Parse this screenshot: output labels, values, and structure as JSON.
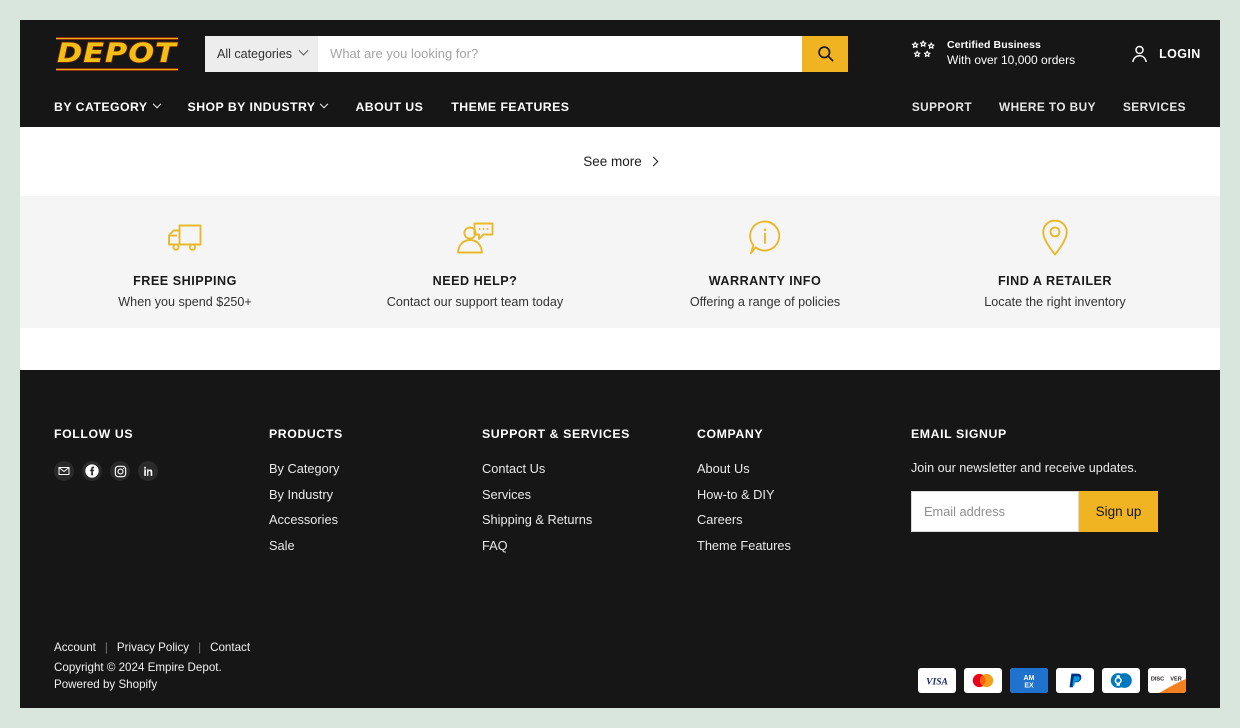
{
  "brand": {
    "logo_text": "DEPOT",
    "accent_color": "#f0b321",
    "logo_yellow": "#f2c014",
    "logo_outline": "#7d2710",
    "header_bg": "#161616"
  },
  "header": {
    "search": {
      "category_label": "All categories",
      "placeholder": "What are you looking for?",
      "value": "",
      "search_icon": "search-icon",
      "chevron_icon": "chevron-down-icon"
    },
    "certified": {
      "icon": "stars-icon",
      "title": "Certified Business",
      "subtitle": "With over 10,000 orders"
    },
    "login": {
      "icon": "user-icon",
      "label": "LOGIN"
    },
    "cart": {
      "icon": "shopping-cart-icon"
    },
    "nav_left": [
      {
        "label": "BY CATEGORY",
        "has_chevron": true
      },
      {
        "label": "SHOP BY INDUSTRY",
        "has_chevron": true
      },
      {
        "label": "ABOUT US",
        "has_chevron": false
      },
      {
        "label": "THEME FEATURES",
        "has_chevron": false
      }
    ],
    "nav_right": [
      {
        "label": "SUPPORT"
      },
      {
        "label": "WHERE TO BUY"
      },
      {
        "label": "SERVICES"
      }
    ]
  },
  "see_more": {
    "label": "See more",
    "icon": "chevron-right-icon"
  },
  "features": [
    {
      "icon": "truck-icon",
      "title": "FREE SHIPPING",
      "subtitle": "When you spend $250+"
    },
    {
      "icon": "support-chat-icon",
      "title": "NEED HELP?",
      "subtitle": "Contact our support team today"
    },
    {
      "icon": "info-bubble-icon",
      "title": "WARRANTY INFO",
      "subtitle": "Offering a range of policies"
    },
    {
      "icon": "map-pin-icon",
      "title": "FIND A RETAILER",
      "subtitle": "Locate the right inventory"
    }
  ],
  "footer": {
    "follow": {
      "heading": "FOLLOW US",
      "socials": [
        {
          "name": "email-icon"
        },
        {
          "name": "facebook-icon"
        },
        {
          "name": "instagram-icon"
        },
        {
          "name": "linkedin-icon"
        }
      ]
    },
    "products": {
      "heading": "PRODUCTS",
      "links": [
        "By Category",
        "By Industry",
        "Accessories",
        "Sale"
      ]
    },
    "support": {
      "heading": "SUPPORT & SERVICES",
      "links": [
        "Contact Us",
        "Services",
        "Shipping & Returns",
        "FAQ"
      ]
    },
    "company": {
      "heading": "COMPANY",
      "links": [
        "About Us",
        "How-to & DIY",
        "Careers",
        "Theme Features"
      ]
    },
    "email_signup": {
      "heading": "EMAIL SIGNUP",
      "description": "Join our newsletter and receive updates.",
      "placeholder": "Email address",
      "value": "",
      "button_label": "Sign up"
    },
    "legal": {
      "links": [
        "Account",
        "Privacy Policy",
        "Contact"
      ],
      "separator": "|",
      "copyright": "Copyright © 2024 Empire Depot.",
      "powered_by": "Powered by Shopify"
    },
    "payments": [
      {
        "name": "visa-icon",
        "label": "VISA"
      },
      {
        "name": "mastercard-icon",
        "label": ""
      },
      {
        "name": "amex-icon",
        "label": "AMEX"
      },
      {
        "name": "paypal-icon",
        "label": ""
      },
      {
        "name": "diners-club-icon",
        "label": ""
      },
      {
        "name": "discover-icon",
        "label": "DISC VER"
      }
    ]
  }
}
